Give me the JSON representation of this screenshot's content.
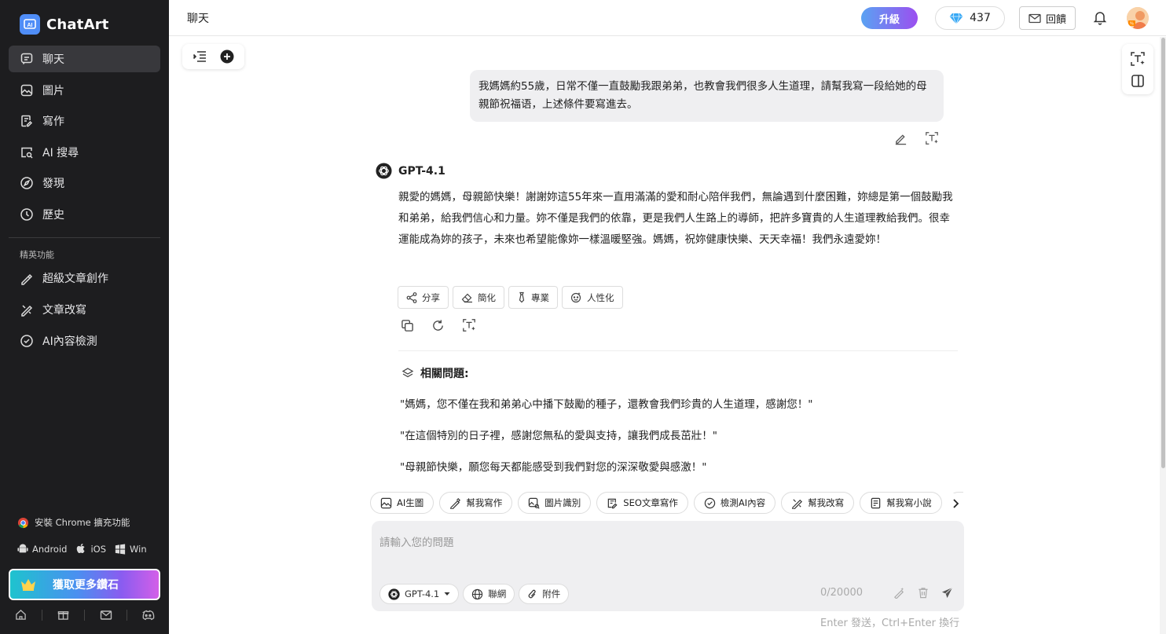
{
  "app": {
    "name": "ChatArt"
  },
  "sidebar": {
    "nav": [
      {
        "label": "聊天",
        "icon": "chat-icon",
        "active": true
      },
      {
        "label": "圖片",
        "icon": "image-icon"
      },
      {
        "label": "寫作",
        "icon": "write-icon"
      },
      {
        "label": "AI 搜尋",
        "icon": "ai-search-icon"
      },
      {
        "label": "發現",
        "icon": "compass-icon"
      },
      {
        "label": "歷史",
        "icon": "history-icon"
      }
    ],
    "section_label": "精英功能",
    "features": [
      {
        "label": "超級文章創作",
        "icon": "magic-pen-icon"
      },
      {
        "label": "文章改寫",
        "icon": "rewrite-icon"
      },
      {
        "label": "AI內容檢測",
        "icon": "check-icon"
      }
    ],
    "chrome_label": "安裝 Chrome 擴充功能",
    "apps": {
      "android": "Android",
      "ios": "iOS",
      "win": "Win"
    },
    "get_diamonds": "獲取更多鑽石",
    "bottom_icons": [
      "home-icon",
      "gift-icon",
      "mail-icon",
      "discord-icon"
    ]
  },
  "topbar": {
    "title": "聊天",
    "upgrade_label": "升級",
    "diamonds": "437",
    "feedback_label": "回饋"
  },
  "chat": {
    "user_message": "我媽媽約55歲，日常不僅一直鼓勵我跟弟弟，也教會我們很多人生道理，請幫我寫一段給她的母親節祝福语，上述條件要寫進去。",
    "model_name": "GPT-4.1",
    "answer": "親愛的媽媽，母親節快樂！謝謝妳這55年來一直用滿滿的愛和耐心陪伴我們，無論遇到什麼困難，妳總是第一個鼓勵我和弟弟，給我們信心和力量。妳不僅是我們的依靠，更是我們人生路上的導師，把許多寶貴的人生道理教給我們。很幸運能成為妳的孩子，未來也希望能像妳一樣溫暖堅強。媽媽，祝妳健康快樂、天天幸福！我們永遠愛妳！",
    "chips": [
      {
        "label": "分享",
        "icon": "share-icon"
      },
      {
        "label": "簡化",
        "icon": "eraser-icon"
      },
      {
        "label": "專業",
        "icon": "tie-icon"
      },
      {
        "label": "人性化",
        "icon": "humanize-icon"
      }
    ],
    "related_title": "相關問題:",
    "related": [
      "\"媽媽，您不僅在我和弟弟心中播下鼓勵的種子，還教會我們珍貴的人生道理，感謝您！\"",
      "\"在這個特別的日子裡，感謝您無私的愛與支持，讓我們成長茁壯！\"",
      "\"母親節快樂，願您每天都能感受到我們對您的深深敬愛與感激！\""
    ]
  },
  "tools": [
    {
      "label": "AI生圖",
      "icon": "image-gen-icon"
    },
    {
      "label": "幫我寫作",
      "icon": "pen-icon"
    },
    {
      "label": "圖片識別",
      "icon": "image-recognize-icon"
    },
    {
      "label": "SEO文章寫作",
      "icon": "seo-doc-icon"
    },
    {
      "label": "檢測AI內容",
      "icon": "check-circle-icon"
    },
    {
      "label": "幫我改寫",
      "icon": "rewrite-icon"
    },
    {
      "label": "幫我寫小說",
      "icon": "book-icon"
    }
  ],
  "input": {
    "placeholder": "請輸入您的問題",
    "model": "GPT-4.1",
    "web_label": "聯網",
    "attach_label": "附件",
    "counter": "0/20000",
    "hint": "Enter 發送，Ctrl+Enter 換行"
  },
  "colors": {
    "sidebar_bg": "#1d1d1f",
    "accent": "#4f8df7",
    "upgrade_gradient": "#5aa2f2→#9b4ff0"
  }
}
